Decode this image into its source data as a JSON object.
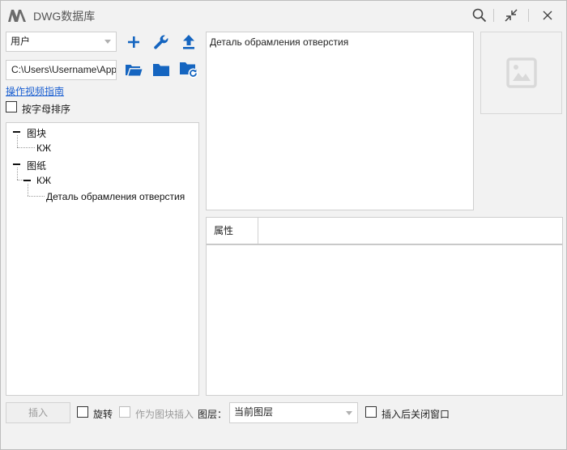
{
  "window": {
    "title": "DWG数据库"
  },
  "toolbar": {
    "user_select": "用户",
    "path_value": "C:\\Users\\Username\\AppData",
    "guide_link": "操作视频指南",
    "sort_label": "按字母排序"
  },
  "tree": {
    "nodes": [
      {
        "label": "图块"
      },
      {
        "label": "КЖ"
      },
      {
        "label": "图纸"
      },
      {
        "label": "КЖ"
      },
      {
        "label": "Деталь обрамления отверстия"
      }
    ]
  },
  "description": {
    "text": "Деталь обрамления отверстия"
  },
  "properties": {
    "header": "属性"
  },
  "footer": {
    "insert_label": "插入",
    "rotate_label": "旋转",
    "as_block_label": "作为图块插入",
    "layer_label": "图层：",
    "layer_value": "当前图层",
    "close_after_label": "插入后关闭窗口"
  },
  "colors": {
    "accent": "#1565c0",
    "link": "#1a5fd1"
  },
  "icons": [
    "app-logo",
    "search-icon",
    "collapse-icon",
    "close-icon",
    "plus-icon",
    "wrench-icon",
    "upload-icon",
    "folder-open-icon",
    "folder-icon",
    "folder-refresh-icon",
    "image-placeholder-icon"
  ]
}
